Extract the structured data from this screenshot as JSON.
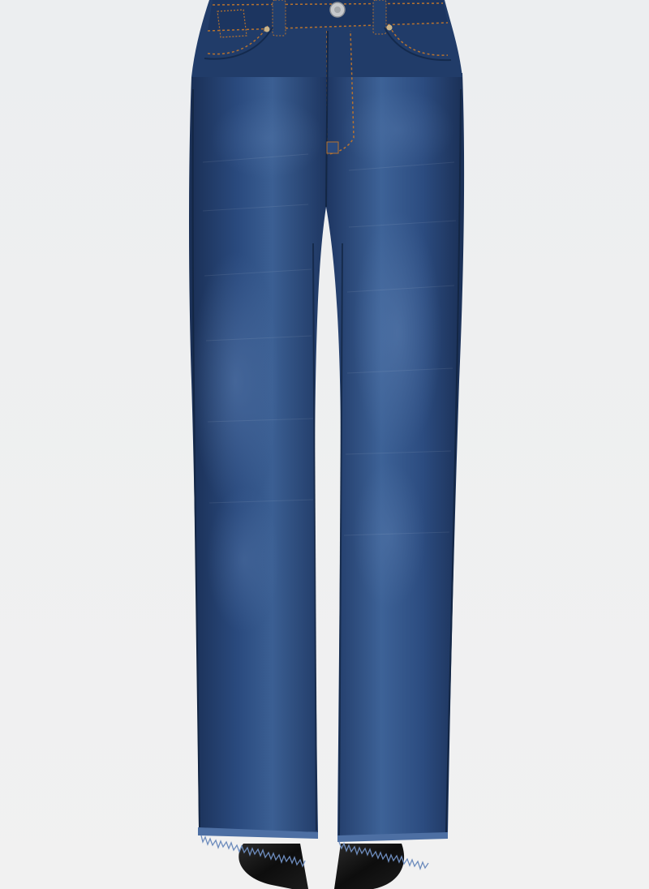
{
  "image": {
    "subject": "dark-wash-wide-leg-jeans",
    "colors": {
      "background_top": "#eceef0",
      "background_bottom": "#f1f1f1",
      "denim_dark": "#1a2f55",
      "denim_mid": "#2a4a7e",
      "denim_light": "#4d6fa3",
      "stitching": "#b8732f",
      "rivet": "#c9b48a",
      "button": "#c7c9cc",
      "shoe": "#121212"
    }
  }
}
